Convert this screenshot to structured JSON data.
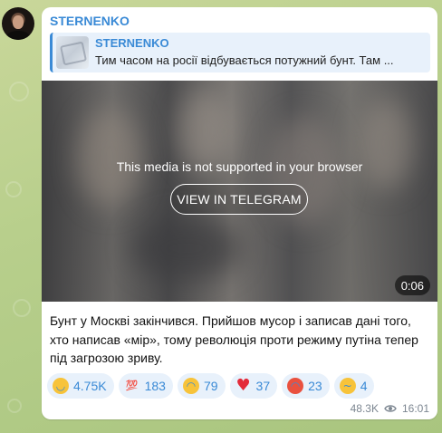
{
  "channel": {
    "name": "STERNENKO"
  },
  "reply": {
    "name": "STERNENKO",
    "text": "Тим часом на росії відбувається потужний бунт. Там ..."
  },
  "media": {
    "message": "This media is not supported in your browser",
    "button_label": "VIEW IN TELEGRAM",
    "duration": "0:06"
  },
  "post": {
    "text": "Бунт у Москві закінчився. Прийшов мусор і записав дані того, хто написав «мір», тому революція проти режиму путіна тепер під загрозою зриву."
  },
  "reactions": [
    {
      "icon": "grinning-face-icon",
      "count": "4.75K"
    },
    {
      "icon": "hundred-points-icon",
      "count": "183"
    },
    {
      "icon": "crying-face-icon",
      "count": "79"
    },
    {
      "icon": "red-heart-icon",
      "count": "37"
    },
    {
      "icon": "angry-face-icon",
      "count": "23"
    },
    {
      "icon": "thinking-face-icon",
      "count": "4"
    }
  ],
  "meta": {
    "views": "48.3K",
    "time": "16:01"
  },
  "colors": {
    "accent": "#3a8ad6",
    "reaction_bg": "#e8f1fb",
    "bubble": "#ffffff",
    "wallpaper": "#b8cf8c"
  }
}
